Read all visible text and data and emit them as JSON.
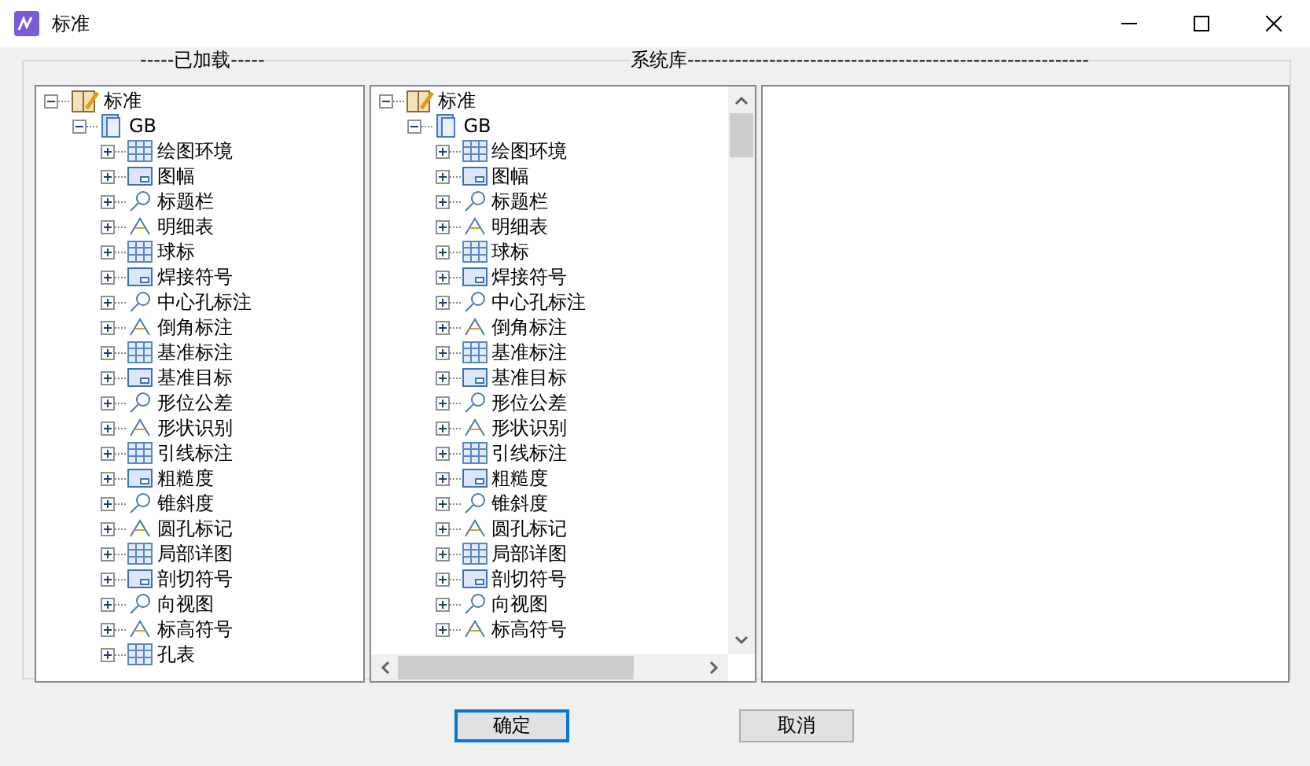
{
  "window": {
    "title": "标准"
  },
  "loaded_panel": {
    "heading": "-----已加载-----",
    "tree": [
      {
        "label": "标准",
        "expanded": true,
        "children": [
          {
            "label": "GB",
            "expanded": true,
            "children": [
              {
                "label": "绘图环境",
                "expanded": false
              },
              {
                "label": "图幅",
                "expanded": false
              },
              {
                "label": "标题栏",
                "expanded": false
              },
              {
                "label": "明细表",
                "expanded": false
              },
              {
                "label": "球标",
                "expanded": false
              },
              {
                "label": "焊接符号",
                "expanded": false
              },
              {
                "label": "中心孔标注",
                "expanded": false
              },
              {
                "label": "倒角标注",
                "expanded": false
              },
              {
                "label": "基准标注",
                "expanded": false
              },
              {
                "label": "基准目标",
                "expanded": false
              },
              {
                "label": "形位公差",
                "expanded": false
              },
              {
                "label": "形状识别",
                "expanded": false
              },
              {
                "label": "引线标注",
                "expanded": false
              },
              {
                "label": "粗糙度",
                "expanded": false
              },
              {
                "label": "锥斜度",
                "expanded": false
              },
              {
                "label": "圆孔标记",
                "expanded": false
              },
              {
                "label": "局部详图",
                "expanded": false
              },
              {
                "label": "剖切符号",
                "expanded": false
              },
              {
                "label": "向视图",
                "expanded": false
              },
              {
                "label": "标高符号",
                "expanded": false
              },
              {
                "label": "孔表",
                "expanded": false
              }
            ]
          }
        ]
      }
    ]
  },
  "library_panel": {
    "heading": "系统库-----------------------------------------------------------",
    "tree": [
      {
        "label": "标准",
        "expanded": true,
        "children": [
          {
            "label": "GB",
            "expanded": true,
            "children": [
              {
                "label": "绘图环境",
                "expanded": false
              },
              {
                "label": "图幅",
                "expanded": false
              },
              {
                "label": "标题栏",
                "expanded": false
              },
              {
                "label": "明细表",
                "expanded": false
              },
              {
                "label": "球标",
                "expanded": false
              },
              {
                "label": "焊接符号",
                "expanded": false
              },
              {
                "label": "中心孔标注",
                "expanded": false
              },
              {
                "label": "倒角标注",
                "expanded": false
              },
              {
                "label": "基准标注",
                "expanded": false
              },
              {
                "label": "基准目标",
                "expanded": false
              },
              {
                "label": "形位公差",
                "expanded": false
              },
              {
                "label": "形状识别",
                "expanded": false
              },
              {
                "label": "引线标注",
                "expanded": false
              },
              {
                "label": "粗糙度",
                "expanded": false
              },
              {
                "label": "锥斜度",
                "expanded": false
              },
              {
                "label": "圆孔标记",
                "expanded": false
              },
              {
                "label": "局部详图",
                "expanded": false
              },
              {
                "label": "剖切符号",
                "expanded": false
              },
              {
                "label": "向视图",
                "expanded": false
              },
              {
                "label": "标高符号",
                "expanded": false
              }
            ]
          }
        ]
      }
    ]
  },
  "buttons": [
    {
      "label": "确定",
      "selected": true
    },
    {
      "label": "取消",
      "selected": false
    }
  ]
}
